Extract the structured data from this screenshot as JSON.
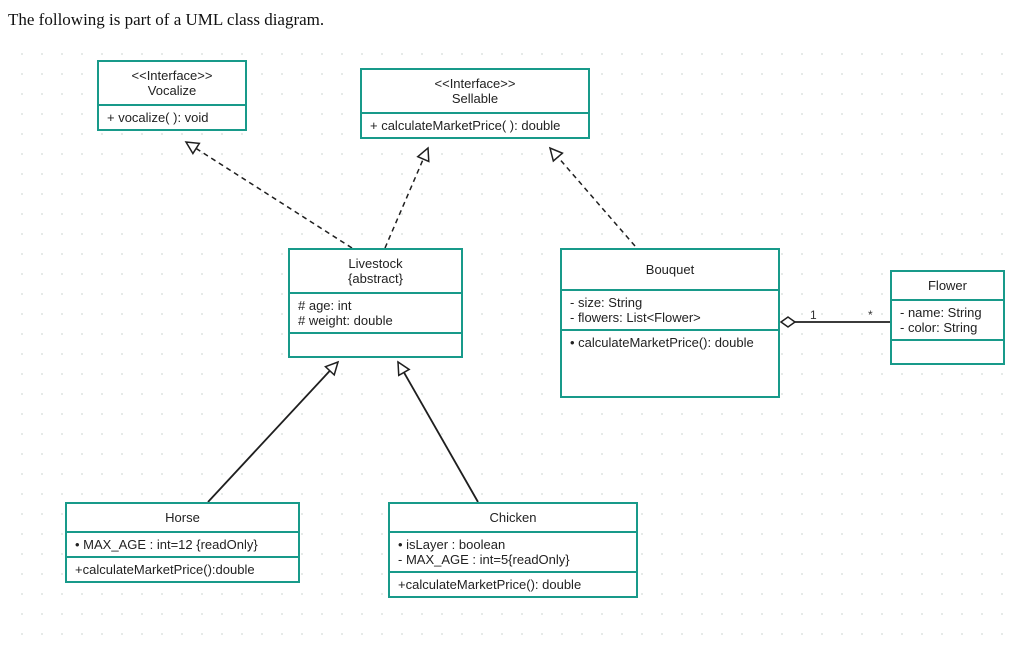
{
  "caption": "The following is part of a UML class diagram.",
  "vocalize": {
    "stereotype": "<<Interface>>",
    "name": "Vocalize",
    "methods": [
      "+ vocalize( ): void"
    ]
  },
  "sellable": {
    "stereotype": "<<Interface>>",
    "name": "Sellable",
    "methods": [
      "+ calculateMarketPrice( ): double"
    ]
  },
  "livestock": {
    "name": "Livestock",
    "modifier": "{abstract}",
    "attributes": [
      "# age: int",
      "# weight: double"
    ]
  },
  "bouquet": {
    "name": "Bouquet",
    "attributes": [
      "- size: String",
      "- flowers: List<Flower>"
    ],
    "methods": [
      "• calculateMarketPrice(): double"
    ]
  },
  "flower": {
    "name": "Flower",
    "attributes": [
      "- name: String",
      "- color: String"
    ]
  },
  "horse": {
    "name": "Horse",
    "attributes": [
      "• MAX_AGE : int=12 {readOnly}"
    ],
    "methods": [
      "+calculateMarketPrice():double"
    ]
  },
  "chicken": {
    "name": "Chicken",
    "attributes": [
      "• isLayer : boolean",
      "- MAX_AGE : int=5{readOnly}"
    ],
    "methods": [
      "+calculateMarketPrice(): double"
    ]
  },
  "multiplicities": {
    "bouquetSide": "1",
    "flowerSide": "*"
  }
}
